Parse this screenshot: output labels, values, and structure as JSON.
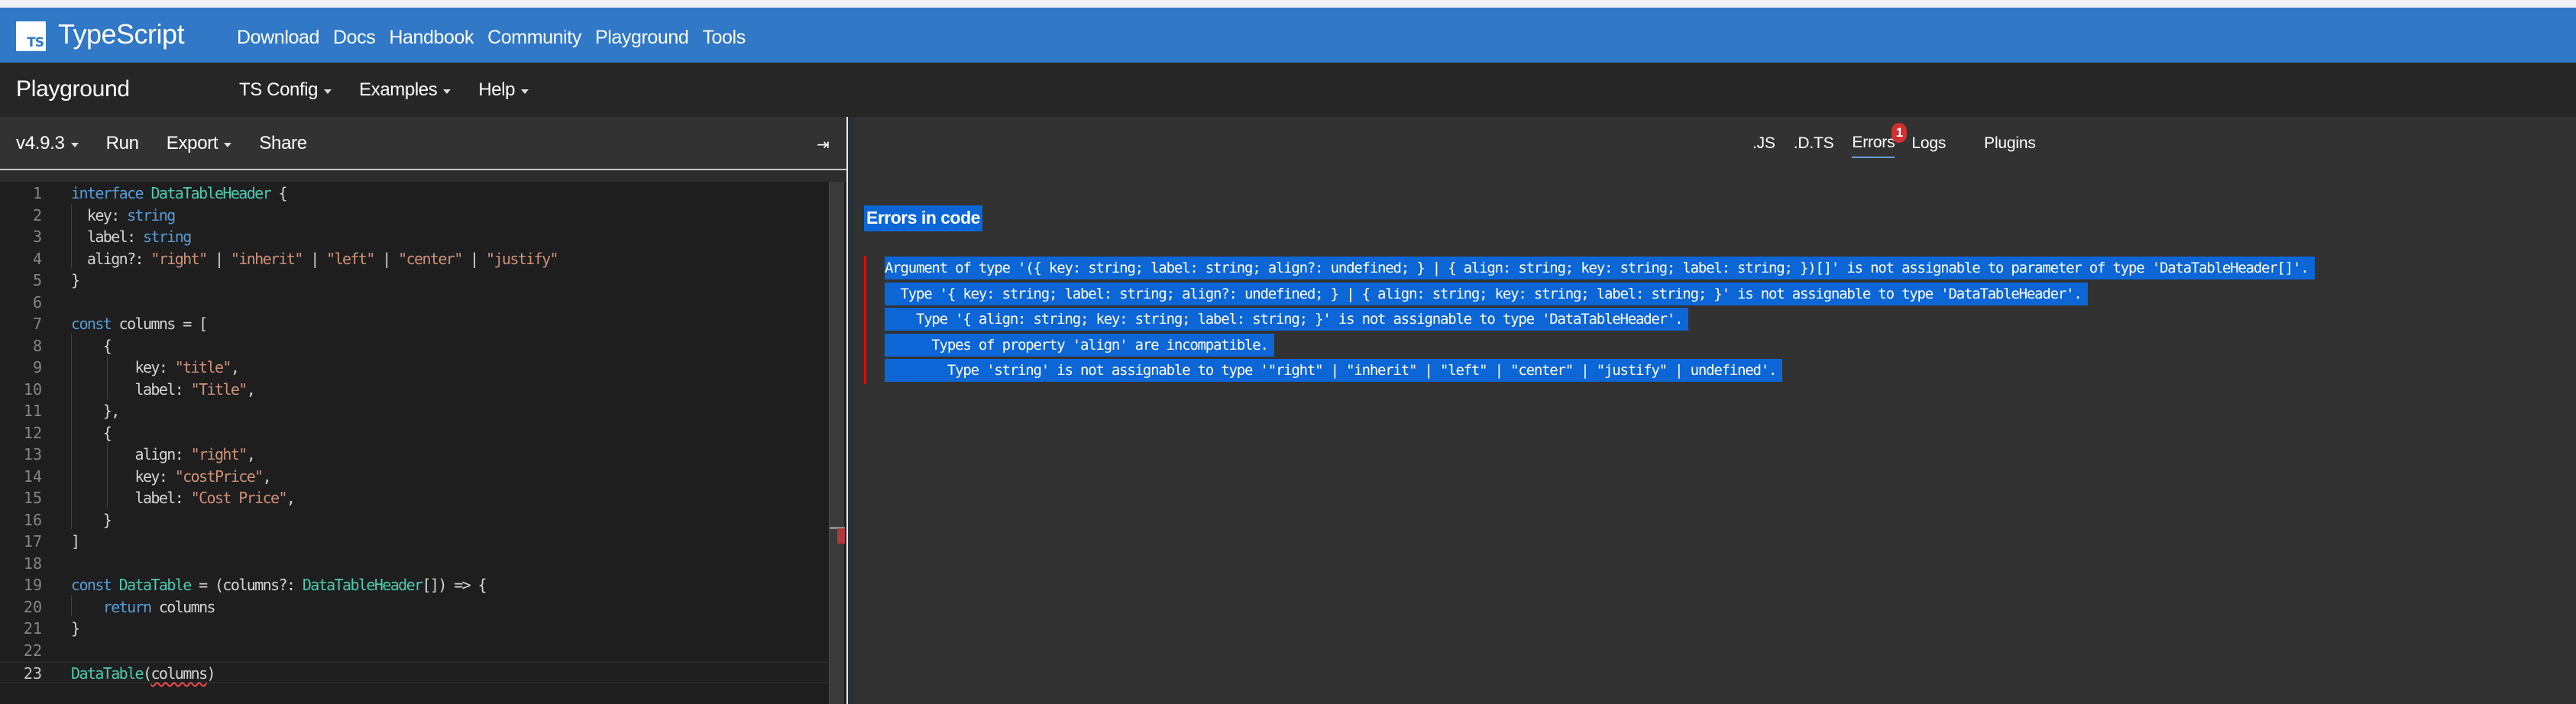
{
  "brand": {
    "logo_text": "TS",
    "name": "TypeScript",
    "nav": [
      "Download",
      "Docs",
      "Handbook",
      "Community",
      "Playground",
      "Tools"
    ]
  },
  "subnav": {
    "title": "Playground",
    "menus": [
      "TS Config",
      "Examples",
      "Help"
    ]
  },
  "toolbar": {
    "version": "v4.9.3",
    "run": "Run",
    "export": "Export",
    "share": "Share",
    "collapse_icon": "⇥"
  },
  "editor": {
    "current_line": 23,
    "lines": [
      {
        "n": "1",
        "html": "<span class='kw'>interface</span> <span class='ty'>DataTableHeader</span> {"
      },
      {
        "n": "2",
        "html": "  key: <span class='kw'>string</span>"
      },
      {
        "n": "3",
        "html": "  label: <span class='kw'>string</span>"
      },
      {
        "n": "4",
        "html": "  align?: <span class='st'>\"right\"</span> | <span class='st'>\"inherit\"</span> | <span class='st'>\"left\"</span> | <span class='st'>\"center\"</span> | <span class='st'>\"justify\"</span>"
      },
      {
        "n": "5",
        "html": "}"
      },
      {
        "n": "6",
        "html": ""
      },
      {
        "n": "7",
        "html": "<span class='kw'>const</span> columns = ["
      },
      {
        "n": "8",
        "html": "    {"
      },
      {
        "n": "9",
        "html": "        key: <span class='st'>\"title\"</span>,"
      },
      {
        "n": "10",
        "html": "        label: <span class='st'>\"Title\"</span>,"
      },
      {
        "n": "11",
        "html": "    },"
      },
      {
        "n": "12",
        "html": "    {"
      },
      {
        "n": "13",
        "html": "        align: <span class='st'>\"right\"</span>,"
      },
      {
        "n": "14",
        "html": "        key: <span class='st'>\"costPrice\"</span>,"
      },
      {
        "n": "15",
        "html": "        label: <span class='st'>\"Cost Price\"</span>,"
      },
      {
        "n": "16",
        "html": "    }"
      },
      {
        "n": "17",
        "html": "]"
      },
      {
        "n": "18",
        "html": ""
      },
      {
        "n": "19",
        "html": "<span class='kw'>const</span> <span class='ty'>DataTable</span> = (columns?: <span class='ty'>DataTableHeader</span>[]) => {"
      },
      {
        "n": "20",
        "html": "    <span class='kw'>return</span> columns"
      },
      {
        "n": "21",
        "html": "}"
      },
      {
        "n": "22",
        "html": ""
      },
      {
        "n": "23",
        "html": "<span class='ty'>DataTable</span>(<span class='squig'>columns</span>)"
      }
    ]
  },
  "sidebar": {
    "tabs": [
      ".JS",
      ".D.TS",
      "Errors",
      "Logs",
      "Plugins"
    ],
    "active_tab": "Errors",
    "error_count": "1",
    "errors_title": "Errors in code",
    "error_lines": [
      "Argument of type '({ key: string; label: string; align?: undefined; } | { align: string; key: string; label: string; })[]' is not assignable to parameter of type 'DataTableHeader[]'.",
      "  Type '{ key: string; label: string; align?: undefined; } | { align: string; key: string; label: string; }' is not assignable to type 'DataTableHeader'.",
      "    Type '{ align: string; key: string; label: string; }' is not assignable to type 'DataTableHeader'.",
      "      Types of property 'align' are incompatible.",
      "        Type 'string' is not assignable to type '\"right\" | \"inherit\" | \"left\" | \"center\" | \"justify\" | undefined'."
    ]
  },
  "colors": {
    "brand_blue": "#3178c6",
    "selection_blue": "#0c66d6",
    "error_red": "#ff0000",
    "badge_red": "#d03030"
  }
}
